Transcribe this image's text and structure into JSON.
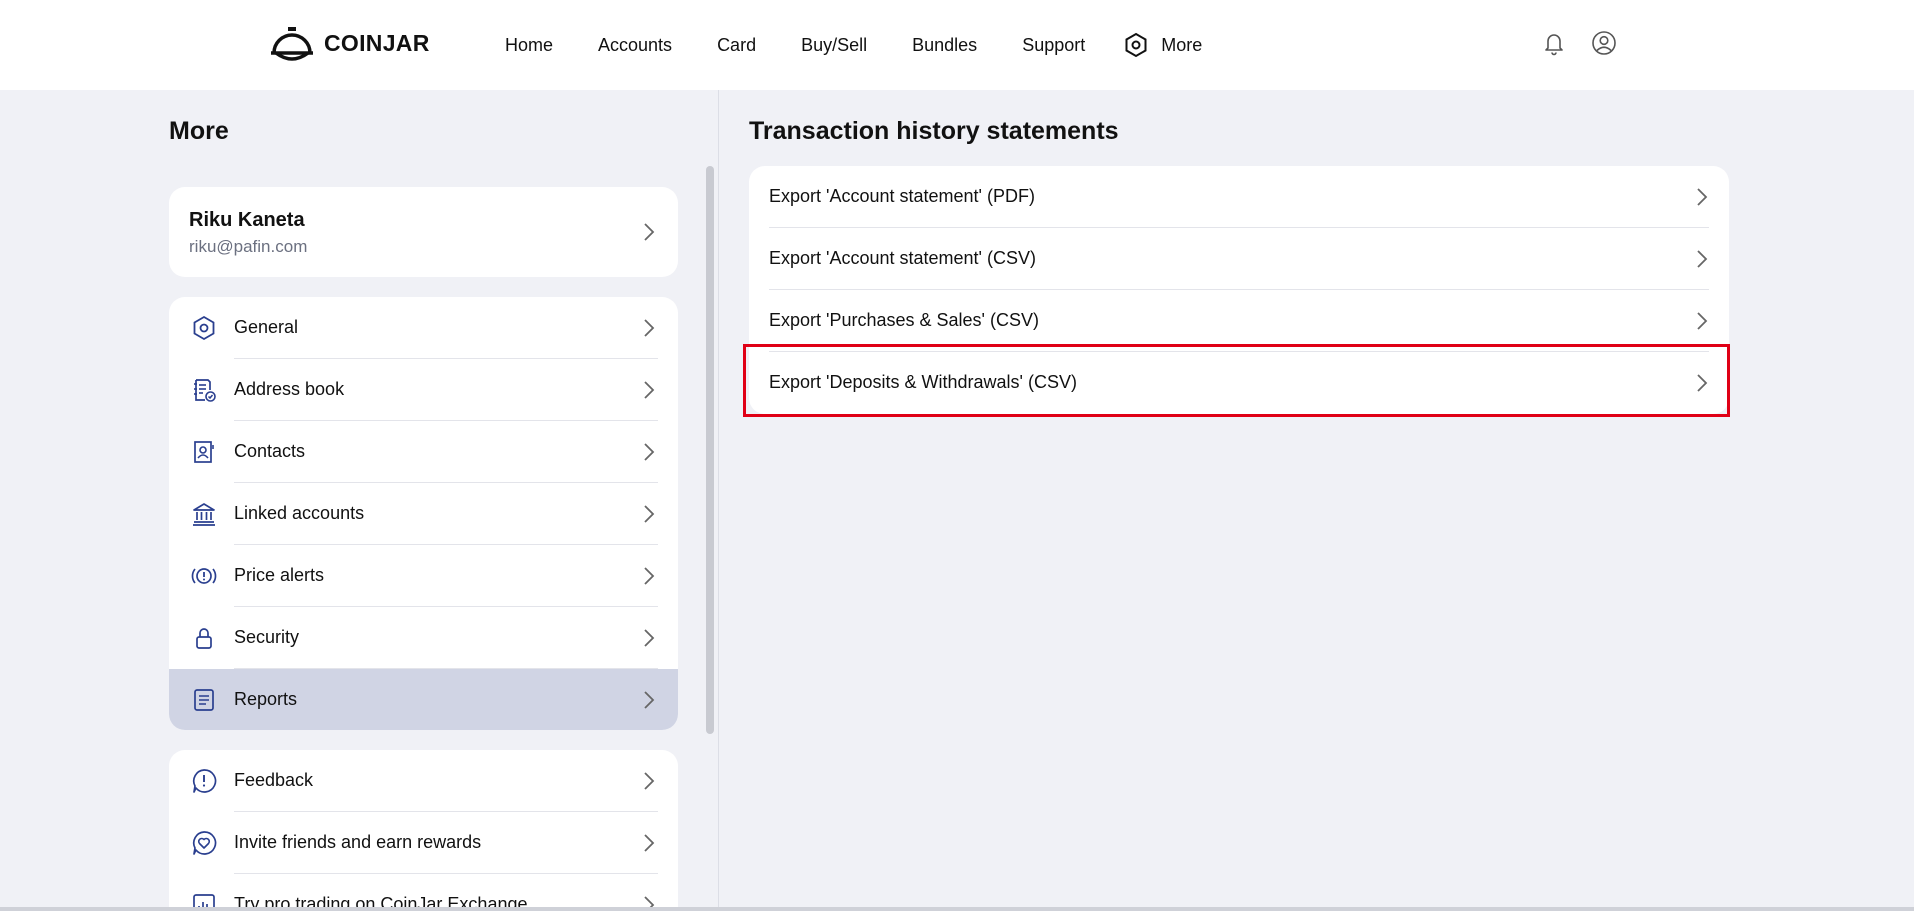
{
  "brand": {
    "logo_text": "COINJAR"
  },
  "nav": {
    "items": [
      {
        "label": "Home"
      },
      {
        "label": "Accounts"
      },
      {
        "label": "Card"
      },
      {
        "label": "Buy/Sell"
      },
      {
        "label": "Bundles"
      },
      {
        "label": "Support"
      },
      {
        "label": "More",
        "icon": "hexagon-icon"
      }
    ],
    "right_icons": [
      "bell-icon",
      "user-circle-icon"
    ]
  },
  "left": {
    "title": "More",
    "user": {
      "name": "Riku Kaneta",
      "email": "riku@pafin.com"
    },
    "menu": [
      {
        "label": "General",
        "icon": "hexagon-gear-icon"
      },
      {
        "label": "Address book",
        "icon": "address-book-icon"
      },
      {
        "label": "Contacts",
        "icon": "contact-card-icon"
      },
      {
        "label": "Linked accounts",
        "icon": "bank-icon"
      },
      {
        "label": "Price alerts",
        "icon": "price-alert-icon"
      },
      {
        "label": "Security",
        "icon": "lock-icon"
      },
      {
        "label": "Reports",
        "icon": "document-icon",
        "active": true
      }
    ],
    "menu2": [
      {
        "label": "Feedback",
        "icon": "feedback-icon"
      },
      {
        "label": "Invite friends and earn rewards",
        "icon": "heart-chat-icon"
      },
      {
        "label": "Try pro trading on CoinJar Exchange",
        "icon": "chart-icon"
      }
    ]
  },
  "right": {
    "title": "Transaction history statements",
    "exports": [
      {
        "label": "Export 'Account statement' (PDF)"
      },
      {
        "label": "Export 'Account statement' (CSV)"
      },
      {
        "label": "Export 'Purchases & Sales' (CSV)"
      },
      {
        "label": "Export 'Deposits & Withdrawals' (CSV)",
        "highlighted": true
      }
    ]
  },
  "colors": {
    "accent_icon": "#2a3f8f",
    "active_row": "#d0d4e4",
    "highlight_border": "#e00016",
    "background": "#f0f1f6"
  }
}
